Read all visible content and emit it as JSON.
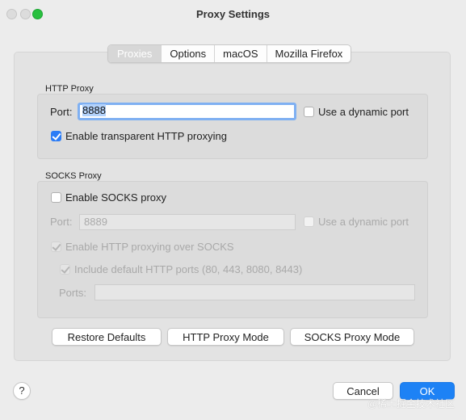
{
  "window": {
    "title": "Proxy Settings"
  },
  "tabs": [
    "Proxies",
    "Options",
    "macOS",
    "Mozilla Firefox"
  ],
  "http_proxy": {
    "section_label": "HTTP Proxy",
    "port_label": "Port:",
    "port_value": "8888",
    "dynamic_port_label": "Use a dynamic port",
    "dynamic_port_checked": false,
    "transparent_label": "Enable transparent HTTP proxying",
    "transparent_checked": true
  },
  "socks_proxy": {
    "section_label": "SOCKS Proxy",
    "enable_label": "Enable SOCKS proxy",
    "enable_checked": false,
    "port_label": "Port:",
    "port_value": "8889",
    "dynamic_port_label": "Use a dynamic port",
    "http_over_socks_label": "Enable HTTP proxying over SOCKS",
    "include_ports_label": "Include default HTTP ports (80, 443, 8080, 8443)",
    "ports_label": "Ports:",
    "ports_value": ""
  },
  "buttons": {
    "restore": "Restore Defaults",
    "http_mode": "HTTP Proxy Mode",
    "socks_mode": "SOCKS Proxy Mode",
    "cancel": "Cancel",
    "ok": "OK",
    "help": "?"
  },
  "watermark": "@稀土掘金技术社区"
}
